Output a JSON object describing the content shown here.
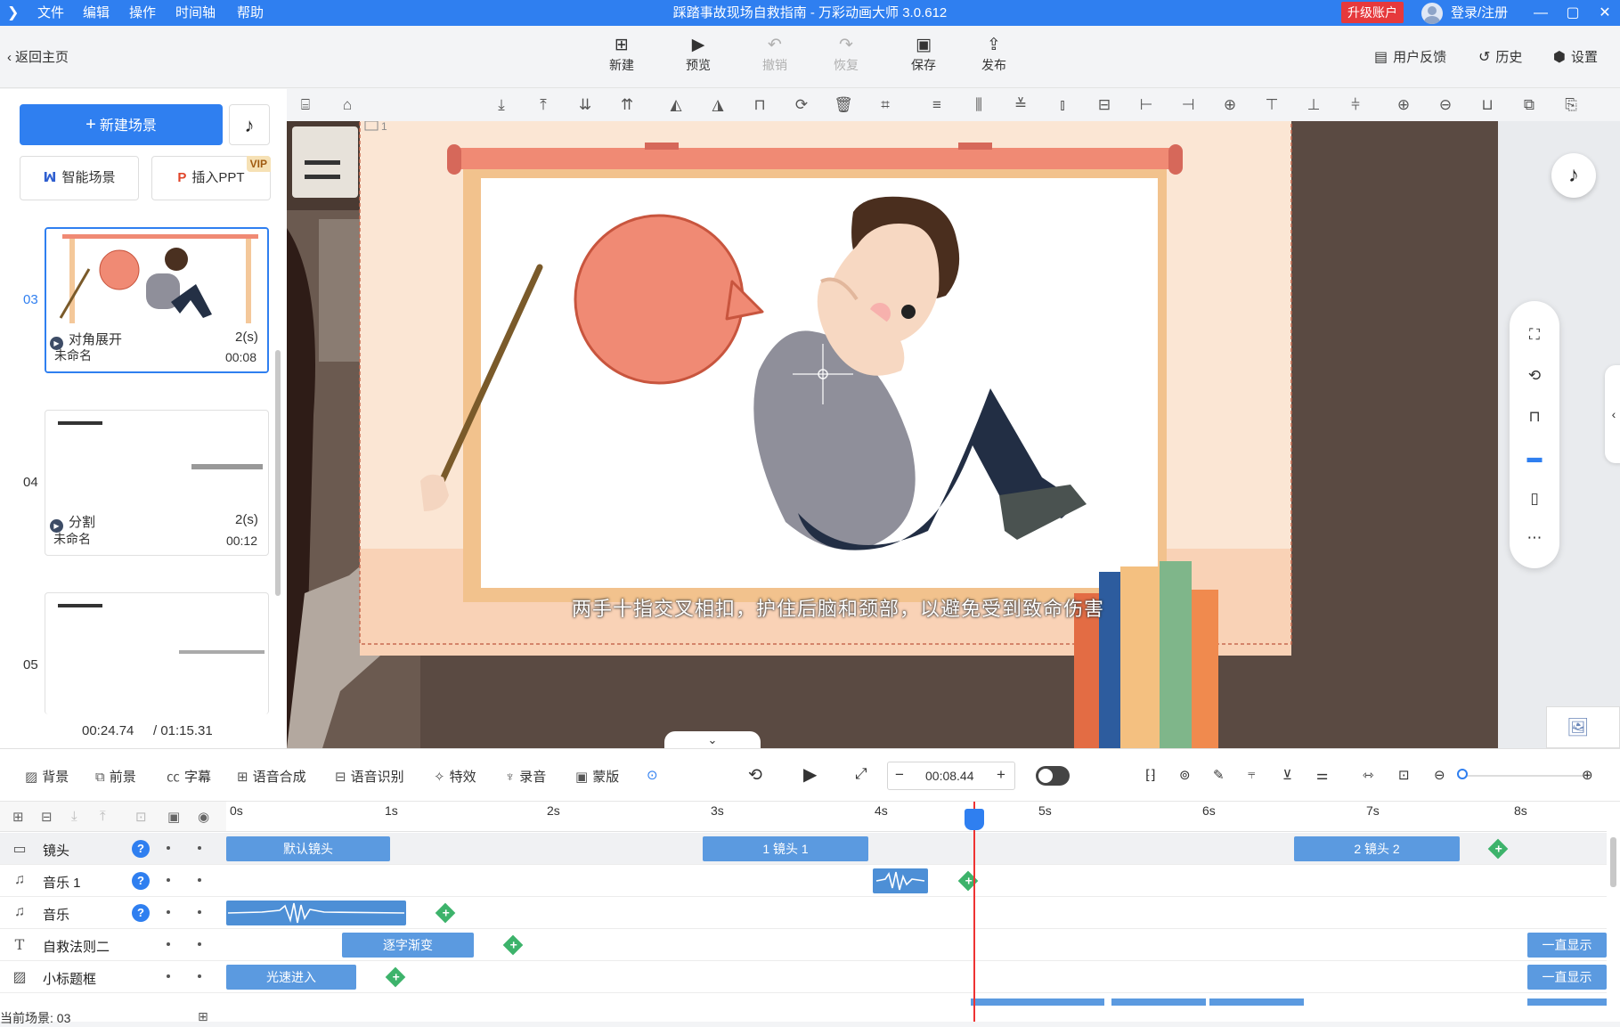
{
  "window": {
    "title": "踩踏事故现场自救指南 - 万彩动画大师 3.0.612",
    "menu": [
      "文件",
      "编辑",
      "操作",
      "时间轴",
      "帮助"
    ],
    "upgrade_label": "升级账户",
    "login_label": "登录/注册"
  },
  "toolbar": {
    "back_label": "返回主页",
    "new_label": "新建",
    "preview_label": "预览",
    "undo_label": "撤销",
    "redo_label": "恢复",
    "save_label": "保存",
    "publish_label": "发布",
    "feedback_label": "用户反馈",
    "history_label": "历史",
    "settings_label": "设置"
  },
  "left_panel": {
    "new_scene_label": "新建场景",
    "smart_scene_label": "智能场景",
    "insert_ppt_label": "插入PPT",
    "vip_badge": "VIP",
    "scenes": [
      {
        "num": "03",
        "name": "未命名",
        "duration": "00:08",
        "transition": "对角展开",
        "transition_dur": "2(s)"
      },
      {
        "num": "04",
        "name": "未命名",
        "duration": "00:12",
        "transition": "分割",
        "transition_dur": "2(s)"
      },
      {
        "num": "05"
      }
    ],
    "current_time": "00:24.74",
    "total_time": "/ 01:15.31"
  },
  "stage": {
    "subtitle": "两手十指交叉相扣，护住后脑和颈部，以避免受到致命伤害",
    "frame_label": "1"
  },
  "timeline_toolbar": {
    "background_label": "背景",
    "foreground_label": "前景",
    "caption_label": "字幕",
    "tts_label": "语音合成",
    "asr_label": "语音识别",
    "effects_label": "特效",
    "record_label": "录音",
    "mask_label": "蒙版",
    "time_value": "00:08.44"
  },
  "timeline": {
    "ticks": [
      "0s",
      "1s",
      "2s",
      "3s",
      "4s",
      "5s",
      "6s",
      "7s",
      "8s"
    ],
    "tracks": [
      {
        "name": "镜头",
        "icon": "camera-icon",
        "clips": [
          "默认镜头",
          "1 镜头 1",
          "2 镜头 2"
        ]
      },
      {
        "name": "音乐 1",
        "icon": "music-note-icon",
        "clips": []
      },
      {
        "name": "音乐",
        "icon": "music-note-icon",
        "clips": []
      },
      {
        "name": "自救法则二",
        "icon": "text-icon",
        "clips": [
          "逐字渐变",
          "一直显示"
        ]
      },
      {
        "name": "小标题框",
        "icon": "image-icon",
        "clips": [
          "光速进入",
          "一直显示"
        ]
      }
    ],
    "current_scene": "当前场景: 03"
  },
  "colors": {
    "accent": "#2f7ff0",
    "clip": "#5b9ae0",
    "keyframe": "#3db36b",
    "playhead": "#e33333",
    "upgrade": "#e6393c"
  }
}
